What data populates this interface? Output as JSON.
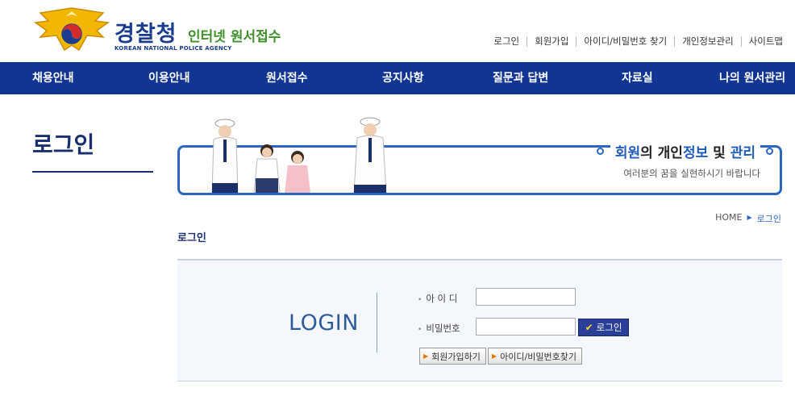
{
  "header": {
    "brand_main": "경찰청",
    "brand_sub": "인터넷 원서접수",
    "brand_eng": "KOREAN NATIONAL POLICE AGENCY",
    "utility_links": [
      "로그인",
      "회원가입",
      "아이디/비밀번호 찾기",
      "개인정보관리",
      "사이트맵"
    ]
  },
  "nav": {
    "items": [
      "채용안내",
      "이용안내",
      "원서접수",
      "공지사항",
      "질문과 답변",
      "자료실",
      "나의 원서관리"
    ]
  },
  "sidebar": {
    "title": "로그인"
  },
  "banner": {
    "headline_prefix": "회원",
    "headline_mid1": "의 개인",
    "headline_highlight2": "정보",
    "headline_mid2": " 및 ",
    "headline_highlight3": "관리",
    "subtitle": "여러분의 꿈을 실현하시기 바랍니다"
  },
  "breadcrumb": {
    "home": "HOME",
    "current": "로그인"
  },
  "page": {
    "heading": "로그인"
  },
  "login": {
    "title": "LOGIN",
    "id_label": "아 이 디",
    "password_label": "비밀번호",
    "id_value": "",
    "password_value": "",
    "login_button": "로그인",
    "join_button": "회원가입하기",
    "find_button": "아이디/비밀번호찾기"
  },
  "colors": {
    "nav_bg": "#113593",
    "accent_blue": "#2b67c2",
    "brand_green": "#3f8f2b"
  }
}
